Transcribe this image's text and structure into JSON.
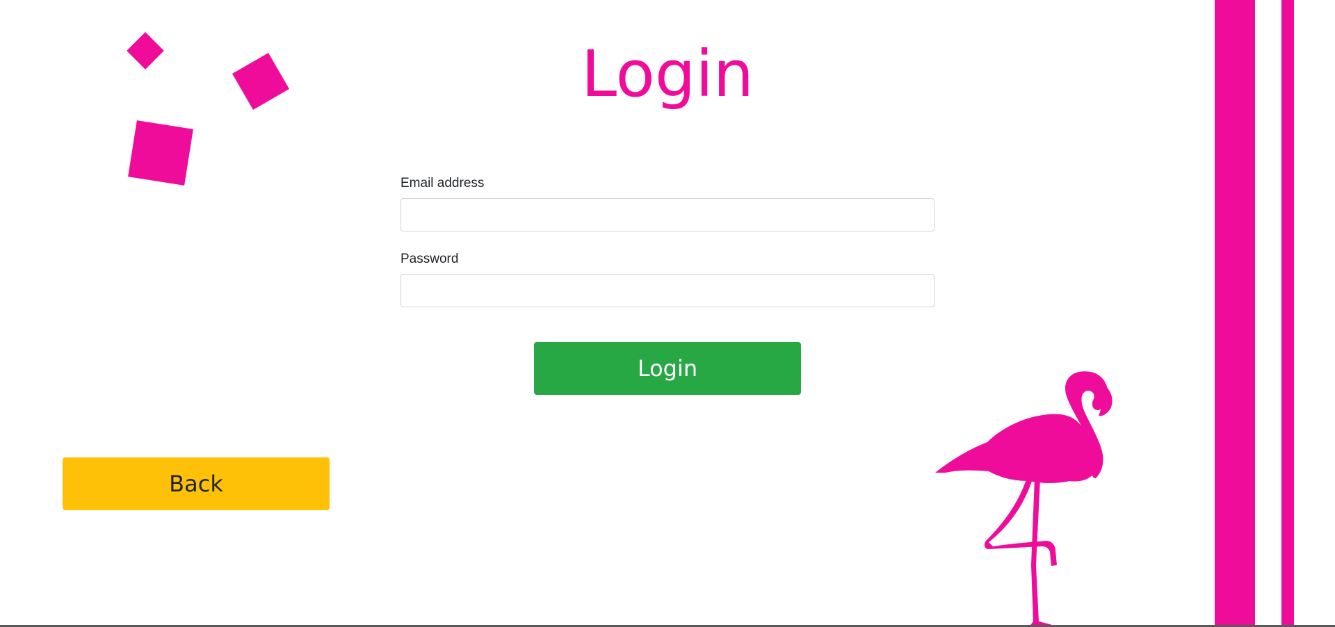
{
  "page": {
    "title": "Login"
  },
  "form": {
    "email_label": "Email address",
    "email_value": "",
    "password_label": "Password",
    "password_value": ""
  },
  "buttons": {
    "login_label": "Login",
    "back_label": "Back"
  },
  "colors": {
    "accent": "#f00c9b",
    "login_button": "#28a745",
    "back_button": "#ffc107"
  },
  "decorations": {
    "illustration": "flamingo-icon"
  }
}
